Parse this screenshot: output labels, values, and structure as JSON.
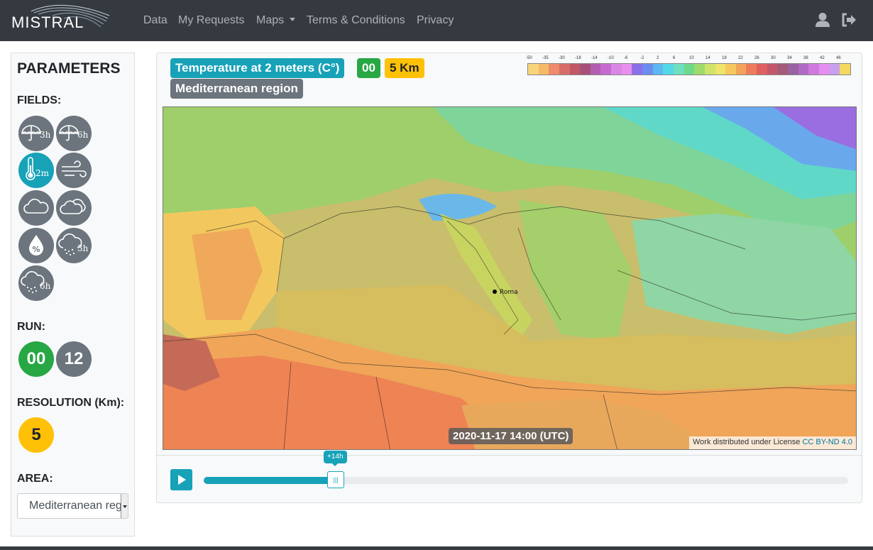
{
  "nav": {
    "brand": "MISTRAL",
    "links": [
      "Data",
      "My Requests",
      "Maps",
      "Terms & Conditions",
      "Privacy"
    ],
    "user_icon": "user-icon",
    "logout_icon": "sign-out-icon"
  },
  "sidebar": {
    "title": "PARAMETERS",
    "fields_label": "FIELDS:",
    "fields": [
      {
        "icon": "umbrella-icon",
        "sub": "3h",
        "active": false
      },
      {
        "icon": "umbrella-icon",
        "sub": "6h",
        "active": false
      },
      {
        "icon": "thermometer-icon",
        "sub": "2m",
        "active": true
      },
      {
        "icon": "wind-icon",
        "sub": "",
        "active": false
      },
      {
        "icon": "cloud-icon",
        "sub": "",
        "active": false
      },
      {
        "icon": "clouds-icon",
        "sub": "",
        "active": false
      },
      {
        "icon": "humidity-icon",
        "sub": "",
        "active": false
      },
      {
        "icon": "snow-cloud-icon",
        "sub": "3h",
        "active": false
      },
      {
        "icon": "snow-cloud-icon",
        "sub": "6h",
        "active": false
      }
    ],
    "run_label": "RUN:",
    "runs": [
      "00",
      "12"
    ],
    "resolution_label": "RESOLUTION (Km):",
    "resolution": "5",
    "area_label": "AREA:",
    "area_value": "Mediterranean region"
  },
  "main": {
    "field_badge": "Temperature at 2 meters (C°)",
    "run_badge": "00",
    "res_badge": "5 Km",
    "area_badge": "Mediterranean region",
    "legend_labels": [
      "-50",
      "-35",
      "-30",
      "-18",
      "-14",
      "-10",
      "-6",
      "-2",
      "2",
      "6",
      "10",
      "14",
      "18",
      "22",
      "26",
      "30",
      "34",
      "38",
      "42",
      "46"
    ],
    "legend_colors": [
      "#f8d57a",
      "#f5b96a",
      "#ee8b6a",
      "#d96b6b",
      "#c05868",
      "#a8507a",
      "#b25db0",
      "#c76ad0",
      "#d987e6",
      "#e98ff0",
      "#8c6ee8",
      "#6c8cf0",
      "#5cb8f0",
      "#54d8e8",
      "#6de0c0",
      "#6fd88a",
      "#9edb6a",
      "#cfe36a",
      "#f0e46a",
      "#f6c85e",
      "#f4a45a",
      "#ee7c5a",
      "#e0605f",
      "#c4586a",
      "#a55a7a",
      "#9a62a0",
      "#b06ac6",
      "#cf78e0",
      "#e68ef0",
      "#c8a0f0",
      "#f4d860"
    ],
    "map_city": "Roma",
    "timestamp": "2020-11-17 14:00 (UTC)",
    "license_text": "Work distributed under License",
    "license_link": "CC BY-ND 4.0",
    "slider_tip": "+14h",
    "slider_progress": 0.205
  }
}
